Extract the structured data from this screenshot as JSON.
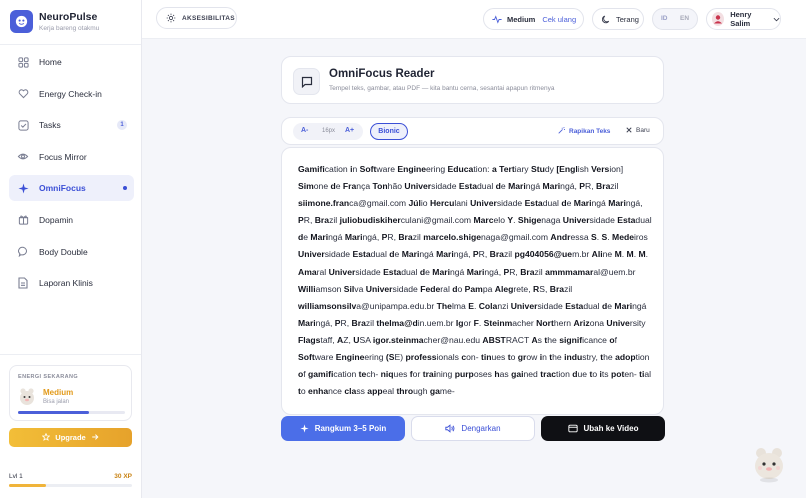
{
  "brand": {
    "name": "NeuroPulse",
    "tagline": "Kerja bareng otakmu"
  },
  "sidebar": {
    "items": [
      {
        "label": "Home",
        "icon": "grid-icon"
      },
      {
        "label": "Energy Check-in",
        "icon": "heart-icon"
      },
      {
        "label": "Tasks",
        "icon": "checkbox-icon",
        "badge": "1"
      },
      {
        "label": "Focus Mirror",
        "icon": "eye-icon"
      },
      {
        "label": "OmniFocus",
        "icon": "sparkle-icon",
        "active": true
      },
      {
        "label": "Dopamin",
        "icon": "gift-icon"
      },
      {
        "label": "Body Double",
        "icon": "chat-icon"
      },
      {
        "label": "Laporan Klinis",
        "icon": "document-icon"
      }
    ],
    "energy": {
      "title": "ENERGI SEKARANG",
      "level": "Medium",
      "status": "Bisa jalan",
      "progress": 0.66
    },
    "upgrade_label": "Upgrade",
    "level": {
      "label": "Lvl 1",
      "xp": "30 XP",
      "progress": 0.3
    }
  },
  "topbar": {
    "accessibility_label": "AKSESIBILITAS",
    "mood": {
      "label": "Medium",
      "action": "Cek ulang"
    },
    "theme_label": "Terang",
    "lang": {
      "id": "ID",
      "en": "EN"
    },
    "user_name": "Henry Salim"
  },
  "reader": {
    "title": "OmniFocus Reader",
    "subtitle": "Tempel teks, gambar, atau PDF — kita bantu cerna, sesantai apapun ritmenya",
    "font_size": "16px",
    "a_minus": "A-",
    "a_plus": "A+",
    "bionic_label": "Bionic",
    "tidy_label": "Rapikan Teks",
    "new_label": "Baru",
    "text": "Gamification in Software Engineering Education: a Tertiary Study [English Version] Simone de França Tonhão Universidade Estadual de Maringá Maringá, PR, Brazil siimone.franca@gmail.com Júlio Herculani Universidade Estadual de Maringá Maringá, PR, Brazil juliobudiskiherculani@gmail.com Marcelo Y. Shigenaga Universidade Estadual de Maringá Maringá, PR, Brazil marcelo.shigenaga@gmail.com Andressa S. S. Medeiros Universidade Estadual de Maringá Maringá, PR, Brazil pg404056@uem.br Aline M. M. M. Amaral Universidade Estadual de Maringá Maringá, PR, Brazil ammmamaral@uem.br Williamson Silva Universidade Federal do Pampa Alegrete, RS, Brazil williamsonsilva@unipampa.edu.br Thelma E. Colanzi Universidade Estadual de Maringá Maringá, PR, Brazil thelma@din.uem.br Igor F. Steinmacher Northern Arizona University Flagstaff, AZ, USA igor.steinmacher@nau.edu ABSTRACT As the significance of Software Engineering (SE) professionals con- tinues to grow in the industry, the adoption of gamification tech- niques for training purposes has gained traction due to its poten- tial to enhance class appeal through game-"
  },
  "actions": {
    "summarize": "Rangkum 3–5 Poin",
    "listen": "Dengarkan",
    "video": "Ubah ke Video"
  },
  "colors": {
    "accent": "#4b5fd9",
    "warning": "#e29a1a",
    "dark": "#0f1014"
  }
}
